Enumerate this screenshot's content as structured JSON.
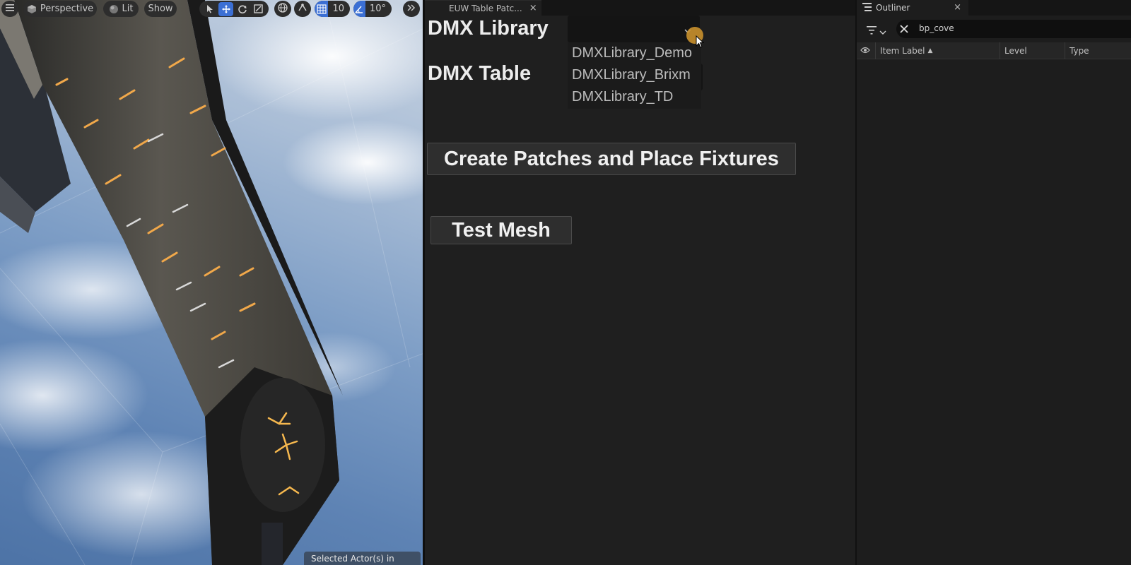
{
  "viewport": {
    "toolbar": {
      "perspective_label": "Perspective",
      "lit_label": "Lit",
      "show_label": "Show",
      "grid_snap_value": "10",
      "rotation_snap_value": "10°"
    },
    "status_text": "Selected Actor(s) in"
  },
  "euw": {
    "tab_title": "EUW Table Patc...",
    "tab_close": "×",
    "library_label": "DMX Library",
    "table_label": "DMX Table",
    "library_dropdown": {
      "selected_value": "",
      "options": [
        "DMXLibrary_Demo",
        "DMXLibrary_Brixm",
        "DMXLibrary_TD"
      ]
    },
    "create_button_label": "Create Patches and Place Fixtures",
    "test_button_label": "Test Mesh"
  },
  "outliner": {
    "tab_title": "Outliner",
    "tab_close": "×",
    "search_value": "bp_cove",
    "columns": [
      "Item Label",
      "Level",
      "Type"
    ],
    "sort_indicator": "▲"
  },
  "colors": {
    "accent": "#3b6fd4",
    "cursor_highlight": "#c9902c",
    "panel_bg": "#1f1f1f"
  }
}
